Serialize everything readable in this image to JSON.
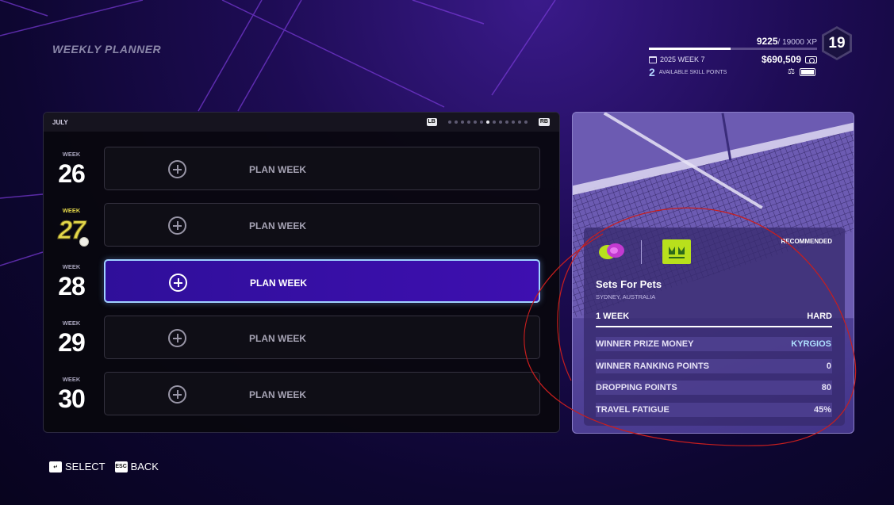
{
  "page": {
    "title": "WEEKLY PLANNER"
  },
  "hud": {
    "xp_current": "9225",
    "xp_max": "/ 19000 XP",
    "xp_progress": 0.486,
    "season": "2025 WEEK 7",
    "money": "$690,509",
    "skill_points": "2",
    "skill_points_label": "AVAILABLE SKILL POINTS",
    "level": "19"
  },
  "planner": {
    "month": "JULY",
    "left_shoulder": "LB",
    "right_shoulder": "RB",
    "page_count": 13,
    "active_page": 7,
    "weeks": [
      {
        "label": "WEEK",
        "number": "26",
        "action": "PLAN WEEK"
      },
      {
        "label": "WEEK",
        "number": "27",
        "action": "PLAN WEEK",
        "current": true
      },
      {
        "label": "WEEK",
        "number": "28",
        "action": "PLAN WEEK",
        "selected": true
      },
      {
        "label": "WEEK",
        "number": "29",
        "action": "PLAN WEEK"
      },
      {
        "label": "WEEK",
        "number": "30",
        "action": "PLAN WEEK"
      }
    ]
  },
  "event": {
    "badge": "RECOMMENDED",
    "name": "Sets For Pets",
    "location": "SYDNEY, AUSTRALIA",
    "duration": "1 WEEK",
    "surface": "HARD",
    "stats": [
      {
        "label": "WINNER PRIZE MONEY",
        "value": "KYRGIOS"
      },
      {
        "label": "WINNER RANKING POINTS",
        "value": "0"
      },
      {
        "label": "DROPPING POINTS",
        "value": "80"
      },
      {
        "label": "TRAVEL FATIGUE",
        "value": "45%"
      }
    ]
  },
  "controls": {
    "select_key": "↵",
    "select_label": "SELECT",
    "back_key": "ESC",
    "back_label": "BACK"
  },
  "colors": {
    "accent_selected": "#3e0fb0",
    "selected_border": "#9fd2ff",
    "current_week": "#e4d84a",
    "card_bg": "#5a4aa0",
    "annotation": "#c81e1e"
  }
}
